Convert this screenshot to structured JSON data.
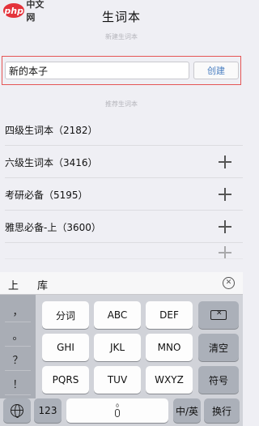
{
  "watermark": {
    "logo": "php",
    "text": "中文网"
  },
  "nav": {
    "title": "生词本"
  },
  "sections": {
    "new_book": "新建生词本",
    "recommended": "推荐生词本"
  },
  "form": {
    "input_value": "新的本子",
    "create_label": "创建"
  },
  "recommended_list": [
    {
      "label": "四级生词本（2182）",
      "has_add": false
    },
    {
      "label": "六级生词本（3416）",
      "has_add": true
    },
    {
      "label": "考研必备（5195）",
      "has_add": true
    },
    {
      "label": "雅思必备-上（3600）",
      "has_add": true
    }
  ],
  "keyboard": {
    "candidates": [
      "上",
      "库"
    ],
    "punctuation": [
      "，",
      "。",
      "？",
      "！"
    ],
    "rows": [
      {
        "main": "分词",
        "sub": ""
      },
      {
        "main": "ABC",
        "sub": ""
      },
      {
        "main": "DEF",
        "sub": ""
      }
    ],
    "row2": [
      "GHI",
      "JKL",
      "MNO"
    ],
    "row3": [
      "PQRS",
      "TUV",
      "WXYZ"
    ],
    "clear_label": "清空",
    "symbol_label": "符号",
    "num_label": "123",
    "space_hint": "0",
    "lang_label": "中/英",
    "enter_label": "换行",
    "icons": [
      "backspace-icon",
      "globe-icon",
      "microphone-icon",
      "close-circle-icon"
    ]
  }
}
